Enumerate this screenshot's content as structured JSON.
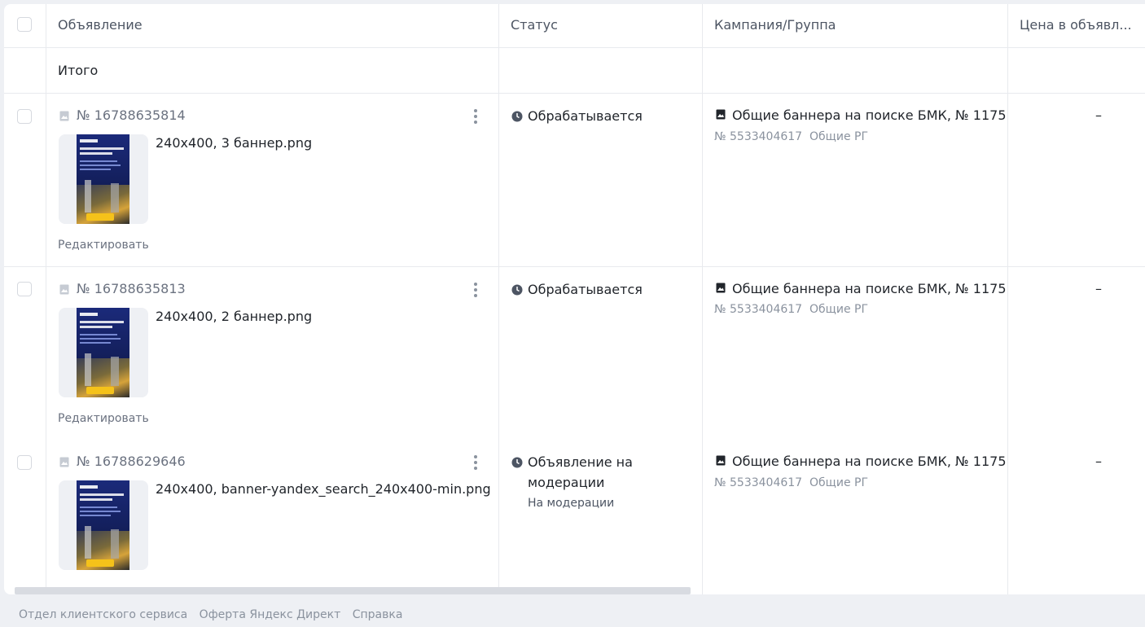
{
  "header": {
    "col_ad": "Объявление",
    "col_status": "Статус",
    "col_campaign": "Кампания/Группа",
    "col_price": "Цена в объявл..."
  },
  "totals_label": "Итого",
  "rows": [
    {
      "ad_id": "№ 16788635814",
      "file_name": "240x400, 3 баннер.png",
      "edit_label": "Редактировать",
      "status": "Обрабатывается",
      "campaign_name": "Общие баннера на поиске БМК, № 1175",
      "group_id": "№ 5533404617",
      "group_name": "Общие РГ",
      "price": "–"
    },
    {
      "ad_id": "№ 16788635813",
      "file_name": "240x400, 2 баннер.png",
      "edit_label": "Редактировать",
      "status": "Обрабатывается",
      "campaign_name": "Общие баннера на поиске БМК, № 1175",
      "group_id": "№ 5533404617",
      "group_name": "Общие РГ",
      "price": "–"
    },
    {
      "ad_id": "№ 16788629646",
      "file_name": "240x400, banner-yandex_search_240x400-min.png",
      "status_line1": "Объявление на",
      "status_line2": "модерации",
      "status_sub": "На модерации",
      "campaign_name": "Общие баннера на поиске БМК, № 1175",
      "group_id": "№ 5533404617",
      "group_name": "Общие РГ",
      "price": "–"
    }
  ],
  "footer": {
    "link1": "Отдел клиентского сервиса",
    "link2": "Оферта Яндекс Директ",
    "link3": "Справка"
  },
  "icons": {
    "ad_type": "image-icon",
    "status": "clock-icon",
    "campaign": "image-icon",
    "menu": "more-vertical-icon"
  }
}
